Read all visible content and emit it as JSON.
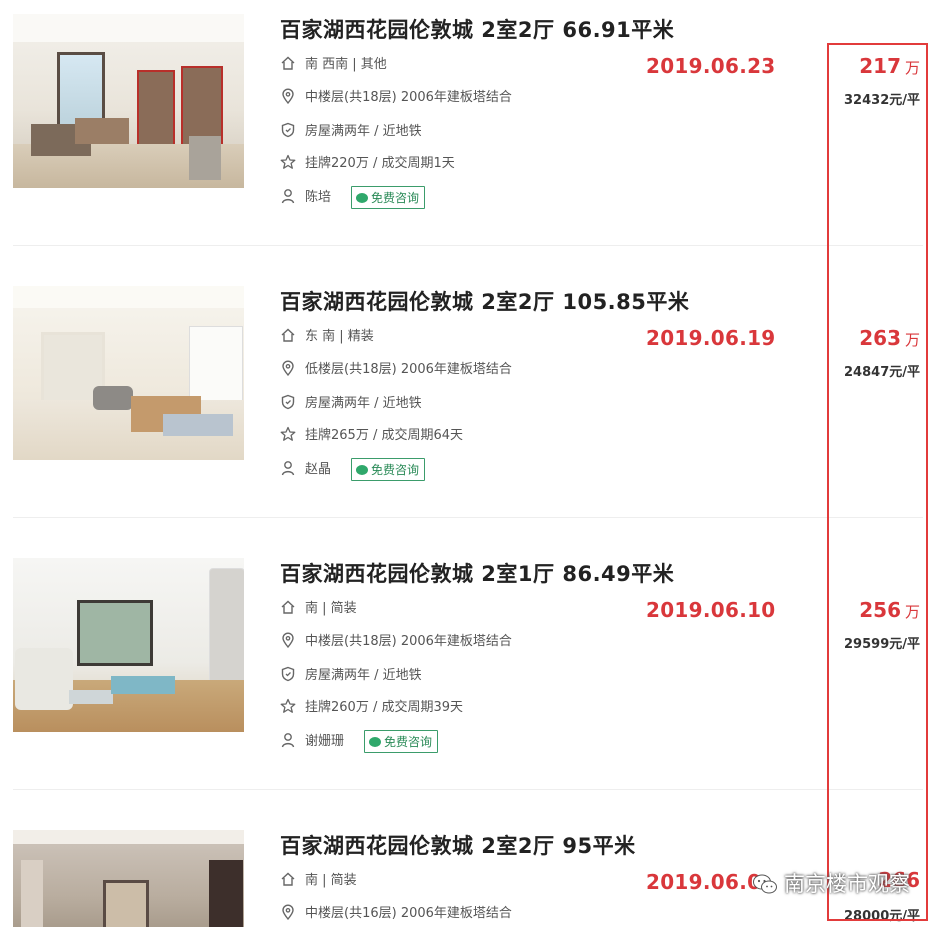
{
  "listings": [
    {
      "title": "百家湖西花园伦敦城 2室2厅 66.91平米",
      "orientation": "南 西南 | 其他",
      "floor": "中楼层(共18层) 2006年建板塔结合",
      "tags": "房屋满两年 / 近地铁",
      "listing": "挂牌220万 / 成交周期1天",
      "agent": "陈培",
      "consult_label": "免费咨询",
      "date": "2019.06.23",
      "total_price": "217",
      "total_unit": "万",
      "unit_price": "32432元/平"
    },
    {
      "title": "百家湖西花园伦敦城 2室2厅 105.85平米",
      "orientation": "东 南 | 精装",
      "floor": "低楼层(共18层) 2006年建板塔结合",
      "tags": "房屋满两年 / 近地铁",
      "listing": "挂牌265万 / 成交周期64天",
      "agent": "赵晶",
      "consult_label": "免费咨询",
      "date": "2019.06.19",
      "total_price": "263",
      "total_unit": "万",
      "unit_price": "24847元/平"
    },
    {
      "title": "百家湖西花园伦敦城 2室1厅 86.49平米",
      "orientation": "南 | 简装",
      "floor": "中楼层(共18层) 2006年建板塔结合",
      "tags": "房屋满两年 / 近地铁",
      "listing": "挂牌260万 / 成交周期39天",
      "agent": "谢姗珊",
      "consult_label": "免费咨询",
      "date": "2019.06.10",
      "total_price": "256",
      "total_unit": "万",
      "unit_price": "29599元/平"
    },
    {
      "title": "百家湖西花园伦敦城 2室2厅 95平米",
      "orientation": "南 | 简装",
      "floor": "中楼层(共16层) 2006年建板塔结合",
      "date": "2019.06.0",
      "total_price": "266",
      "unit_price": "28000元/平"
    }
  ],
  "watermark": "南京楼市观察",
  "colors": {
    "accent_red": "#d9373b",
    "box_red": "#e23b3b",
    "consult_green": "#2a8a57"
  }
}
